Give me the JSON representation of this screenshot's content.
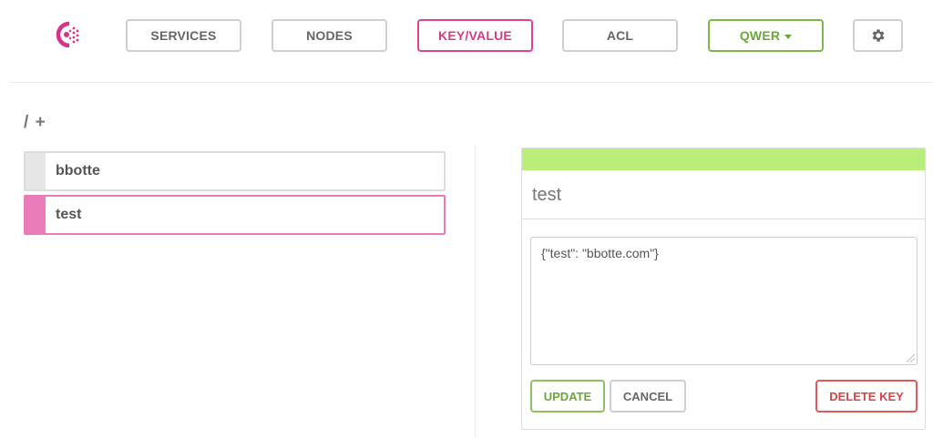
{
  "nav": {
    "items": [
      {
        "label": "SERVICES"
      },
      {
        "label": "NODES"
      },
      {
        "label": "KEY/VALUE"
      },
      {
        "label": "ACL"
      },
      {
        "label": "QWER"
      }
    ],
    "active": "KEY/VALUE",
    "settings_icon": "gear-icon",
    "logo_icon": "consul-logo"
  },
  "breadcrumb": {
    "root": "/",
    "add": "+"
  },
  "keys": [
    {
      "label": "bbotte"
    },
    {
      "label": "test"
    }
  ],
  "selected_key": "test",
  "editor": {
    "title": "test",
    "value": "{\"test\": \"bbotte.com\"}",
    "update_label": "UPDATE",
    "cancel_label": "CANCEL",
    "delete_label": "DELETE KEY"
  },
  "colors": {
    "accent": "#e2418d",
    "datacenter": "#7db845",
    "status_ok": "#b9ee7b",
    "danger": "#e05858"
  }
}
